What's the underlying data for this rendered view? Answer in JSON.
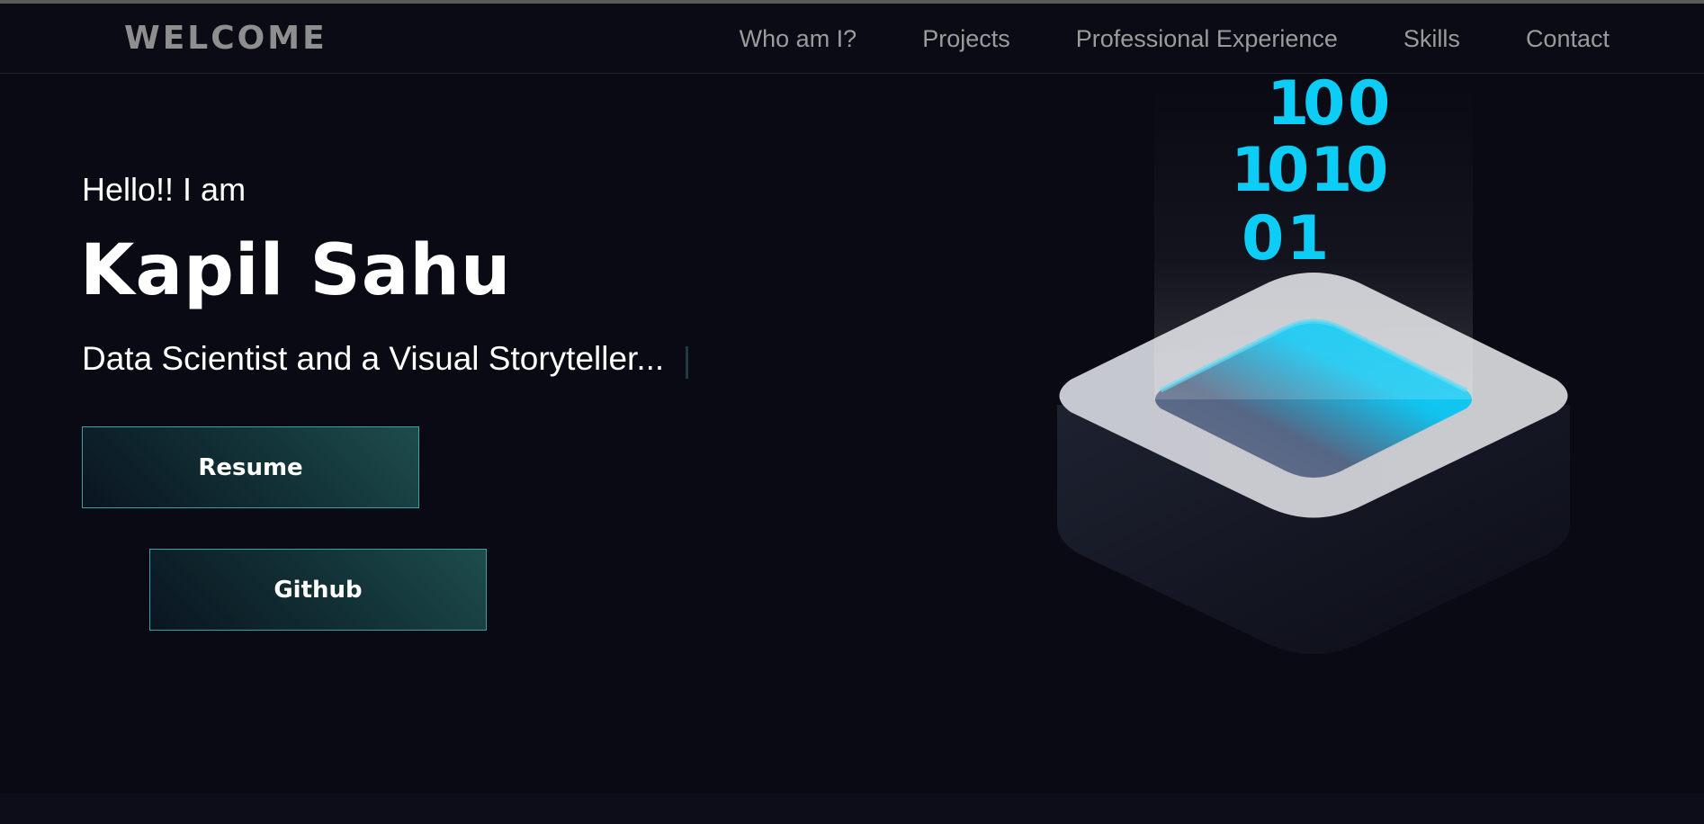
{
  "navbar": {
    "brand": "WELCOME",
    "links": [
      "Who am I?",
      "Projects",
      "Professional Experience",
      "Skills",
      "Contact"
    ]
  },
  "hero": {
    "greeting": "Hello!! I am",
    "name": "Kapil Sahu",
    "tagline": "Data Scientist and a Visual Storyteller..."
  },
  "buttons": {
    "resume": "Resume",
    "github": "Github"
  },
  "illustration": {
    "digits": [
      "1",
      "0",
      "0",
      "1",
      "0",
      "1",
      "0",
      "0",
      "1"
    ],
    "digit_color": "#0ccdf5",
    "icon": "data-platform-icon"
  },
  "colors": {
    "background": "#0a0a14",
    "accent": "#3aa3a0",
    "nav_text": "#9b9b9b"
  }
}
